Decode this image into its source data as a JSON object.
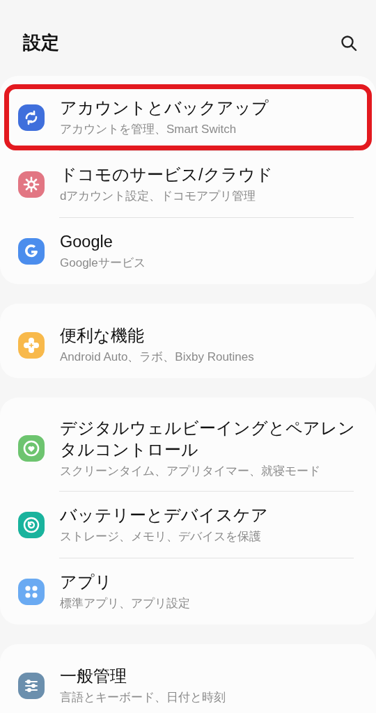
{
  "header": {
    "title": "設定"
  },
  "groups": [
    {
      "cut_off": false,
      "items": [
        {
          "kind": "sync",
          "color": "#3f6fdc",
          "title": "アカウントとバックアップ",
          "subtitle": "アカウントを管理、Smart Switch",
          "highlighted": true
        },
        {
          "kind": "gear",
          "color": "#e27683",
          "title": "ドコモのサービス/クラウド",
          "subtitle": "dアカウント設定、ドコモアプリ管理",
          "highlighted": false
        },
        {
          "kind": "google",
          "color": "#4b8ded",
          "title": "Google",
          "subtitle": "Googleサービス",
          "highlighted": false
        }
      ]
    },
    {
      "cut_off": false,
      "items": [
        {
          "kind": "puzzle",
          "color": "#f8b94b",
          "title": "便利な機能",
          "subtitle": "Android Auto、ラボ、Bixby Routines",
          "highlighted": false
        }
      ]
    },
    {
      "cut_off": false,
      "items": [
        {
          "kind": "heart",
          "color": "#6dc46f",
          "title": "デジタルウェルビーイングとペアレンタルコントロール",
          "subtitle": "スクリーンタイム、アプリタイマー、就寝モード",
          "highlighted": false
        },
        {
          "kind": "care",
          "color": "#19b39d",
          "title": "バッテリーとデバイスケア",
          "subtitle": "ストレージ、メモリ、デバイスを保護",
          "highlighted": false
        },
        {
          "kind": "apps",
          "color": "#6aaaf2",
          "title": "アプリ",
          "subtitle": "標準アプリ、アプリ設定",
          "highlighted": false
        }
      ]
    },
    {
      "cut_off": true,
      "items": [
        {
          "kind": "sliders",
          "color": "#6b8fad",
          "title": "一般管理",
          "subtitle": "言語とキーボード、日付と時刻",
          "highlighted": false
        }
      ]
    }
  ]
}
